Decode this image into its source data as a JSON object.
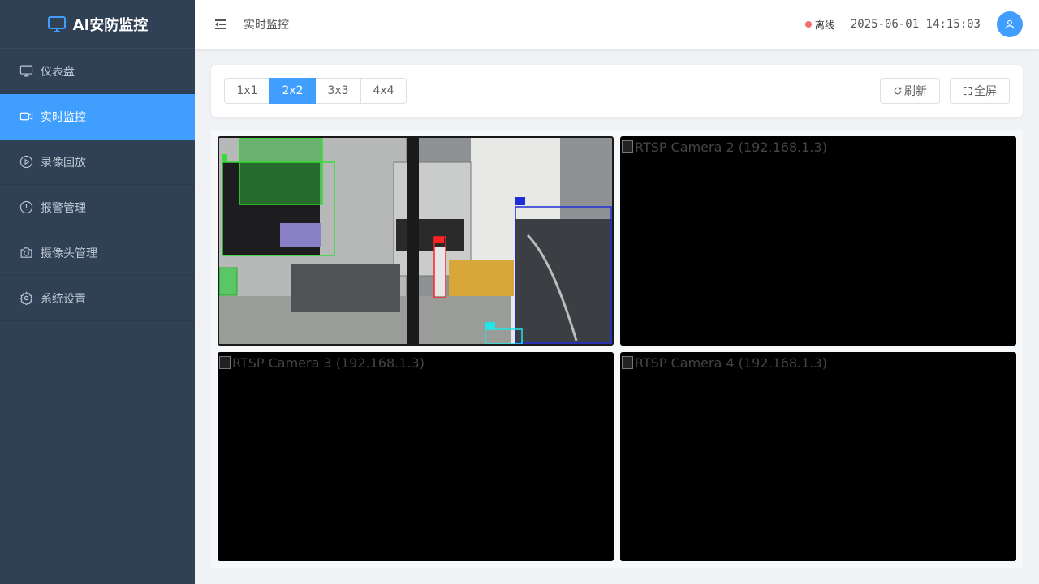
{
  "brand": {
    "title": "AI安防监控",
    "icon": "monitor-icon"
  },
  "sidebar": {
    "items": [
      {
        "label": "仪表盘",
        "icon": "monitor-icon",
        "active": false
      },
      {
        "label": "实时监控",
        "icon": "video-camera-icon",
        "active": true
      },
      {
        "label": "录像回放",
        "icon": "play-circle-icon",
        "active": false
      },
      {
        "label": "报警管理",
        "icon": "warning-circle-icon",
        "active": false
      },
      {
        "label": "摄像头管理",
        "icon": "camera-icon",
        "active": false
      },
      {
        "label": "系统设置",
        "icon": "gear-icon",
        "active": false
      }
    ]
  },
  "header": {
    "breadcrumb": "实时监控",
    "status": "离线",
    "status_color": "#f56c6c",
    "datetime": "2025-06-01 14:15:03"
  },
  "toolbar": {
    "layouts": [
      "1x1",
      "2x2",
      "3x3",
      "4x4"
    ],
    "active_layout": "2x2",
    "refresh_label": "刷新",
    "fullscreen_label": "全屏"
  },
  "cameras": [
    {
      "alt": "",
      "has_feed": true
    },
    {
      "alt": "RTSP Camera 2 (192.168.1.3)",
      "has_feed": false
    },
    {
      "alt": "RTSP Camera 3 (192.168.1.3)",
      "has_feed": false
    },
    {
      "alt": "RTSP Camera 4 (192.168.1.3)",
      "has_feed": false
    }
  ],
  "colors": {
    "accent": "#409eff",
    "sidebar_bg": "#304156"
  }
}
